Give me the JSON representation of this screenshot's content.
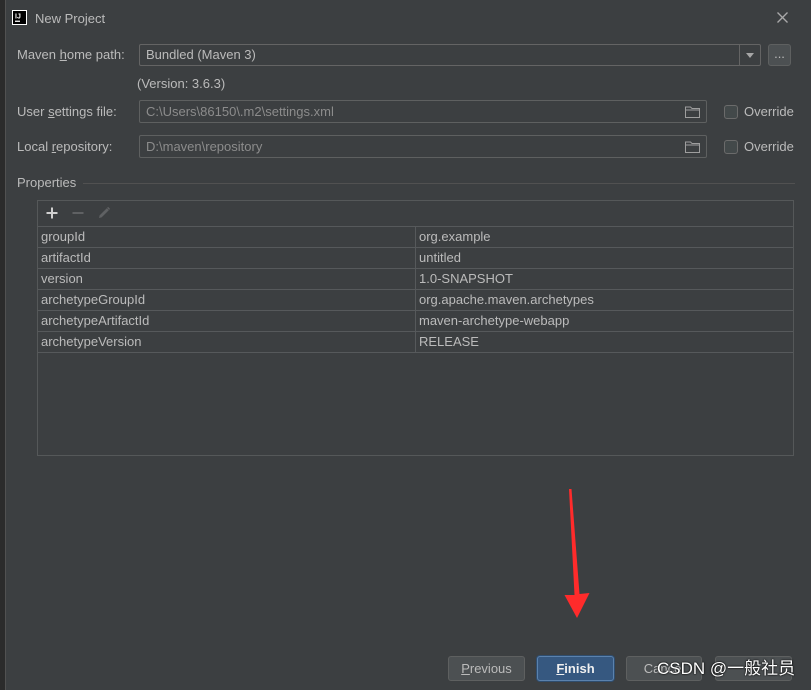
{
  "window": {
    "title": "New Project",
    "logo_text": "IJ"
  },
  "form": {
    "maven_home": {
      "label": "Maven home path:",
      "mnemonic": "h",
      "value": "Bundled (Maven 3)",
      "browse_label": "...",
      "version_note": "(Version: 3.6.3)"
    },
    "user_settings": {
      "label": "User settings file:",
      "mnemonic": "s",
      "value": "C:\\Users\\86150\\.m2\\settings.xml",
      "override_label": "Override",
      "override_checked": false
    },
    "local_repo": {
      "label": "Local repository:",
      "mnemonic": "r",
      "value": "D:\\maven\\repository",
      "override_label": "Override",
      "override_checked": false
    }
  },
  "properties": {
    "title": "Properties",
    "rows": [
      {
        "key": "groupId",
        "value": "org.example"
      },
      {
        "key": "artifactId",
        "value": "untitled"
      },
      {
        "key": "version",
        "value": "1.0-SNAPSHOT"
      },
      {
        "key": "archetypeGroupId",
        "value": "org.apache.maven.archetypes"
      },
      {
        "key": "archetypeArtifactId",
        "value": "maven-archetype-webapp"
      },
      {
        "key": "archetypeVersion",
        "value": "RELEASE"
      }
    ]
  },
  "buttons": {
    "previous": {
      "label": "Previous",
      "mnemonic": "P"
    },
    "finish": {
      "label": "Finish",
      "mnemonic": "F"
    },
    "cancel": {
      "label": "Cancel"
    }
  },
  "watermark": "CSDN @一般社员",
  "icons": {
    "logo": "intellij-logo",
    "close": "close-icon",
    "dropdown": "chevron-down-icon",
    "folder": "folder-icon",
    "add": "plus-icon",
    "remove": "minus-icon",
    "edit": "pencil-icon"
  },
  "colors": {
    "dialog_background": "#3c3f41",
    "default_button": "#365880",
    "disabled_text": "#8c8c8c",
    "annotation_arrow": "#ff2b2b"
  }
}
